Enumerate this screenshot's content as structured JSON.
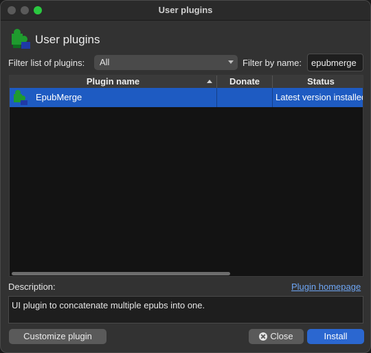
{
  "window": {
    "title": "User plugins"
  },
  "header": {
    "title": "User plugins",
    "icon": "puzzle-piece-icon"
  },
  "filters": {
    "list_label": "Filter list of plugins:",
    "list_selected": "All",
    "name_label": "Filter by name:",
    "name_value": "epubmerge"
  },
  "table": {
    "columns": [
      "Plugin name",
      "Donate",
      "Status"
    ],
    "rows": [
      {
        "name": "EpubMerge",
        "donate": "",
        "status": "Latest version installed"
      }
    ]
  },
  "description": {
    "label": "Description:",
    "homepage_link": "Plugin homepage",
    "text": "UI plugin to concatenate multiple epubs into one."
  },
  "buttons": {
    "customize": "Customize plugin",
    "close": "Close",
    "install": "Install"
  },
  "colors": {
    "accent": "#2b67d0",
    "selection": "#1e5bc2",
    "link": "#6ea6f5"
  }
}
